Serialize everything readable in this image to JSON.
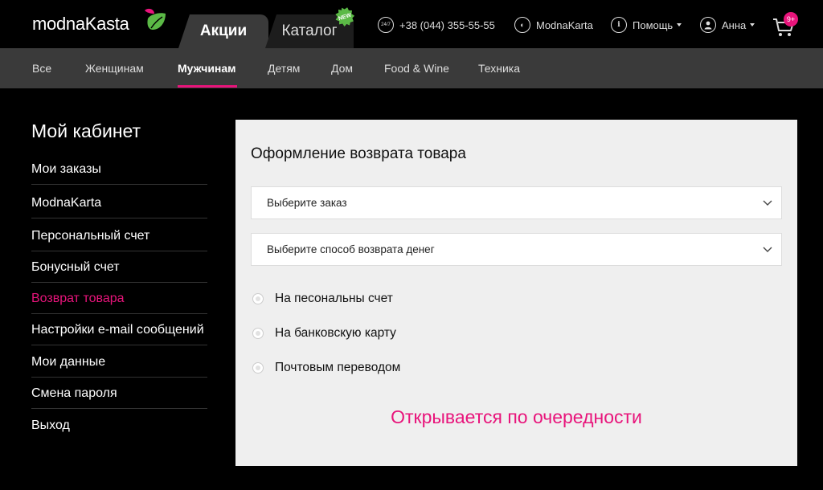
{
  "header": {
    "logo_text": "modnaKasta",
    "tabs": [
      {
        "label": "Акции"
      },
      {
        "label": "Каталог"
      }
    ],
    "new_badge": "NEW",
    "phone_icon_text": "24/7",
    "phone": "+38 (044) 355-55-55",
    "modnakarta": "ModnaKarta",
    "help": "Помощь",
    "user": "Анна",
    "cart_count": "9+",
    "icons": {
      "phone": "phone-24-icon",
      "card": "modnakarta-icon",
      "help": "info-icon",
      "user": "user-icon",
      "cart": "cart-icon"
    }
  },
  "categories": [
    {
      "label": "Все"
    },
    {
      "label": "Женщинам"
    },
    {
      "label": "Мужчинам"
    },
    {
      "label": "Детям"
    },
    {
      "label": "Дом"
    },
    {
      "label": "Food & Wine"
    },
    {
      "label": "Техника"
    }
  ],
  "sidebar": {
    "title": "Мой кабинет",
    "items": [
      {
        "label": "Мои заказы"
      },
      {
        "label": "ModnaKarta"
      },
      {
        "label": "Персональный счет"
      },
      {
        "label": "Бонусный счет"
      },
      {
        "label": "Возврат товара"
      },
      {
        "label": "Настройки e-mail сообщений"
      },
      {
        "label": "Мои данные"
      },
      {
        "label": "Смена пароля"
      },
      {
        "label": "Выход"
      }
    ]
  },
  "main": {
    "title": "Оформление возврата товара",
    "order_select": "Выберите заказ",
    "refund_select": "Выберите способ возврата денег",
    "refund_options": [
      {
        "label": "На песональны счет"
      },
      {
        "label": "На банковскую карту"
      },
      {
        "label": "Почтовым переводом"
      }
    ],
    "notice": "Открывается по очередности"
  },
  "colors": {
    "accent": "#e8147b",
    "leaf_green": "#5bb946",
    "nav_bg": "#3a3a3a",
    "panel_bg": "#efefef"
  }
}
